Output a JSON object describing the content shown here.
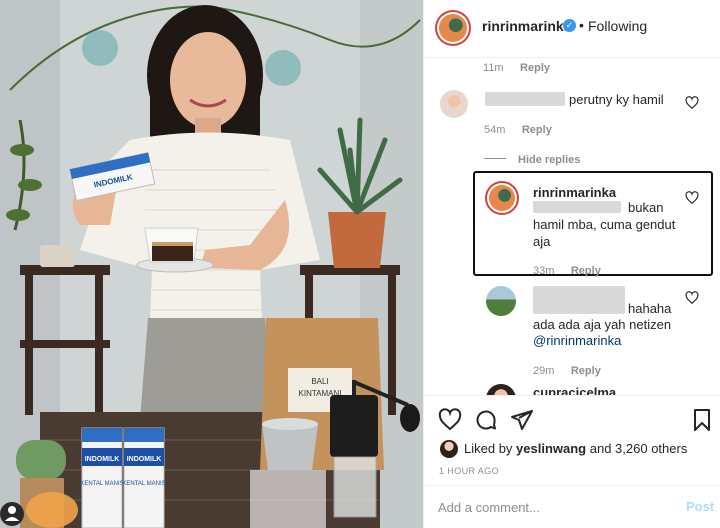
{
  "header": {
    "username": "rinrinmarinka",
    "separator": "•",
    "follow_status": "Following"
  },
  "comments": [
    {
      "time": "11m",
      "reply": "Reply"
    },
    {
      "text": "perutny ky hamil",
      "time": "54m",
      "reply": "Reply",
      "hide_replies": "Hide replies"
    },
    {
      "username": "rinrinmarinka",
      "text_a": "bukan",
      "text_b": "hamil mba, cuma gendut",
      "text_c": "aja",
      "time": "33m",
      "reply": "Reply"
    },
    {
      "text_a": "hahaha",
      "text_b": "ada ada aja yah netizen",
      "mention": "@rinrinmarinka",
      "time": "29m",
      "reply": "Reply"
    },
    {
      "username": "cupracicelma"
    }
  ],
  "photo": {
    "milk_brand": "INDOMILK",
    "milk_label": "KENTAL MANIS",
    "bag_label_a": "BALI",
    "bag_label_b": "KINTAMANI"
  },
  "likes": {
    "prefix": "Liked by",
    "user": "yeslinwang",
    "rest": "and 3,260 others"
  },
  "timestamp": "1 HOUR AGO",
  "add_comment": {
    "placeholder": "Add a comment...",
    "post_label": "Post"
  },
  "colors": {
    "accent": "#3897f0",
    "link": "#00376b",
    "ring": "#d43f3a"
  }
}
